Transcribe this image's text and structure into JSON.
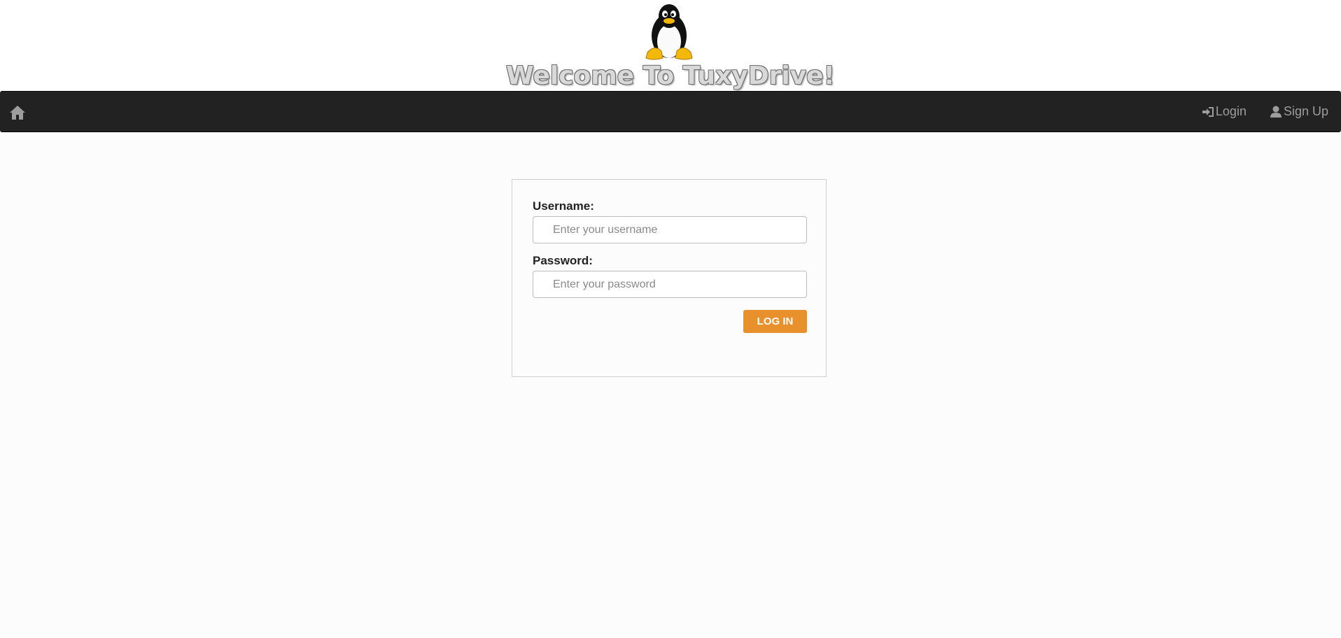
{
  "header": {
    "title": "Welcome To TuxyDrive!",
    "logo": "tux-penguin-logo"
  },
  "navbar": {
    "home_icon": "home-icon",
    "login_label": "Login",
    "login_icon": "sign-in-icon",
    "signup_label": "Sign Up",
    "signup_icon": "user-icon",
    "background": "#222222",
    "link_color": "#9d9d9d"
  },
  "login_form": {
    "username_label": "Username:",
    "username_placeholder": "Enter your username",
    "username_value": "",
    "password_label": "Password:",
    "password_placeholder": "Enter your password",
    "password_value": "",
    "submit_label": "LOG IN",
    "submit_color": "#e8912c"
  }
}
